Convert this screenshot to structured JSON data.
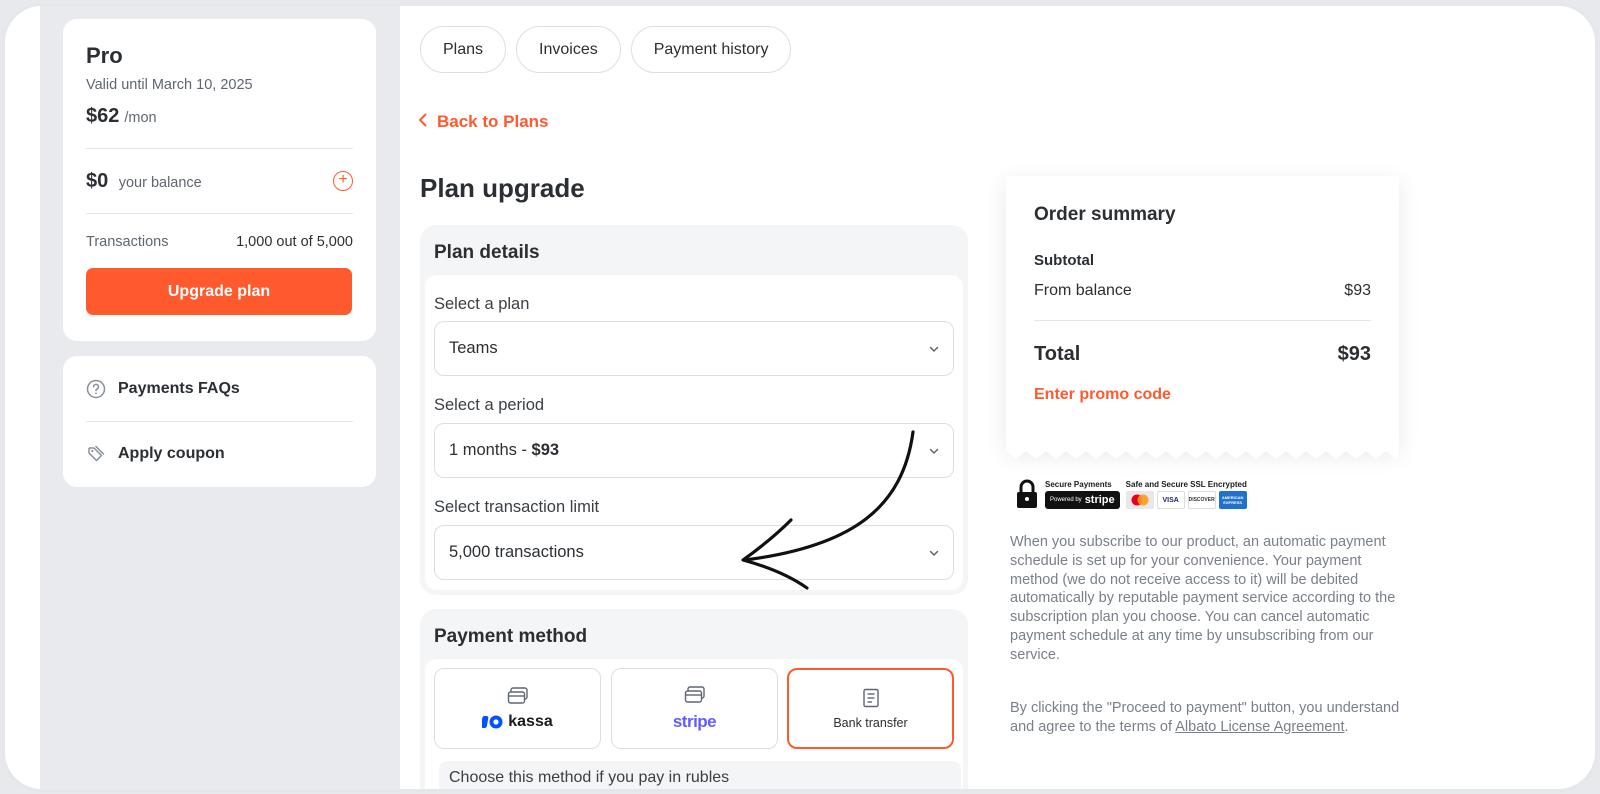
{
  "sidebar": {
    "plan": {
      "name": "Pro",
      "valid_until": "Valid until March 10, 2025",
      "price": "$62",
      "price_unit": "/mon",
      "balance_value": "$0",
      "balance_label": "your balance",
      "add_balance_icon": "plus-circle-icon",
      "transactions_label": "Transactions",
      "transactions_value": "1,000 out of 5,000",
      "upgrade_label": "Upgrade plan"
    },
    "links": [
      {
        "label": "Payments FAQs",
        "icon": "question-circle-icon"
      },
      {
        "label": "Apply coupon",
        "icon": "tag-icon"
      }
    ]
  },
  "tabs": [
    {
      "label": "Plans"
    },
    {
      "label": "Invoices"
    },
    {
      "label": "Payment history"
    }
  ],
  "back_link": "Back to Plans",
  "page_title": "Plan upgrade",
  "plan_details": {
    "title": "Plan details",
    "plan_label": "Select a plan",
    "plan_value": "Teams",
    "period_label": "Select a period",
    "period_value_prefix": "1 months - ",
    "period_value_price": "$93",
    "limit_label": "Select transaction limit",
    "limit_value": "5,000 transactions"
  },
  "payment_method": {
    "title": "Payment method",
    "options": [
      {
        "name": "kassa",
        "brand": "kassa",
        "icon": "card-icon"
      },
      {
        "name": "stripe",
        "brand": "stripe",
        "icon": "card-icon"
      },
      {
        "name": "bank-transfer",
        "label": "Bank transfer",
        "icon": "receipt-icon",
        "selected": true
      }
    ],
    "note": "Choose this method if you pay in rubles"
  },
  "order_summary": {
    "title": "Order summary",
    "subtotal_label": "Subtotal",
    "from_balance_label": "From balance",
    "from_balance_value": "$93",
    "total_label": "Total",
    "total_value": "$93",
    "promo_label": "Enter promo code"
  },
  "security_badges": {
    "secure_payments": "Secure Payments",
    "powered_by": "Powered by",
    "stripe": "stripe",
    "ssl": "Safe and Secure SSL Encrypted",
    "cards": [
      "MasterCard",
      "VISA",
      "DISCOVER",
      "AMERICAN EXPRESS"
    ]
  },
  "legal": {
    "subscription_text": "When you subscribe to our product, an automatic payment schedule is set up for your convenience. Your payment method (we do not receive access to it) will be debited automatically by reputable payment service according to the subscription plan you choose. You can cancel automatic payment schedule at any time by unsubscribing from our service.",
    "agreement_prefix": "By clicking the \"Proceed to payment\" button, you understand and agree to the terms of ",
    "agreement_link": "Albato License Agreement",
    "agreement_suffix": "."
  },
  "colors": {
    "accent": "#ff5a2d",
    "stripe": "#635bff",
    "text": "#2b2f33",
    "muted": "#7a808a"
  }
}
